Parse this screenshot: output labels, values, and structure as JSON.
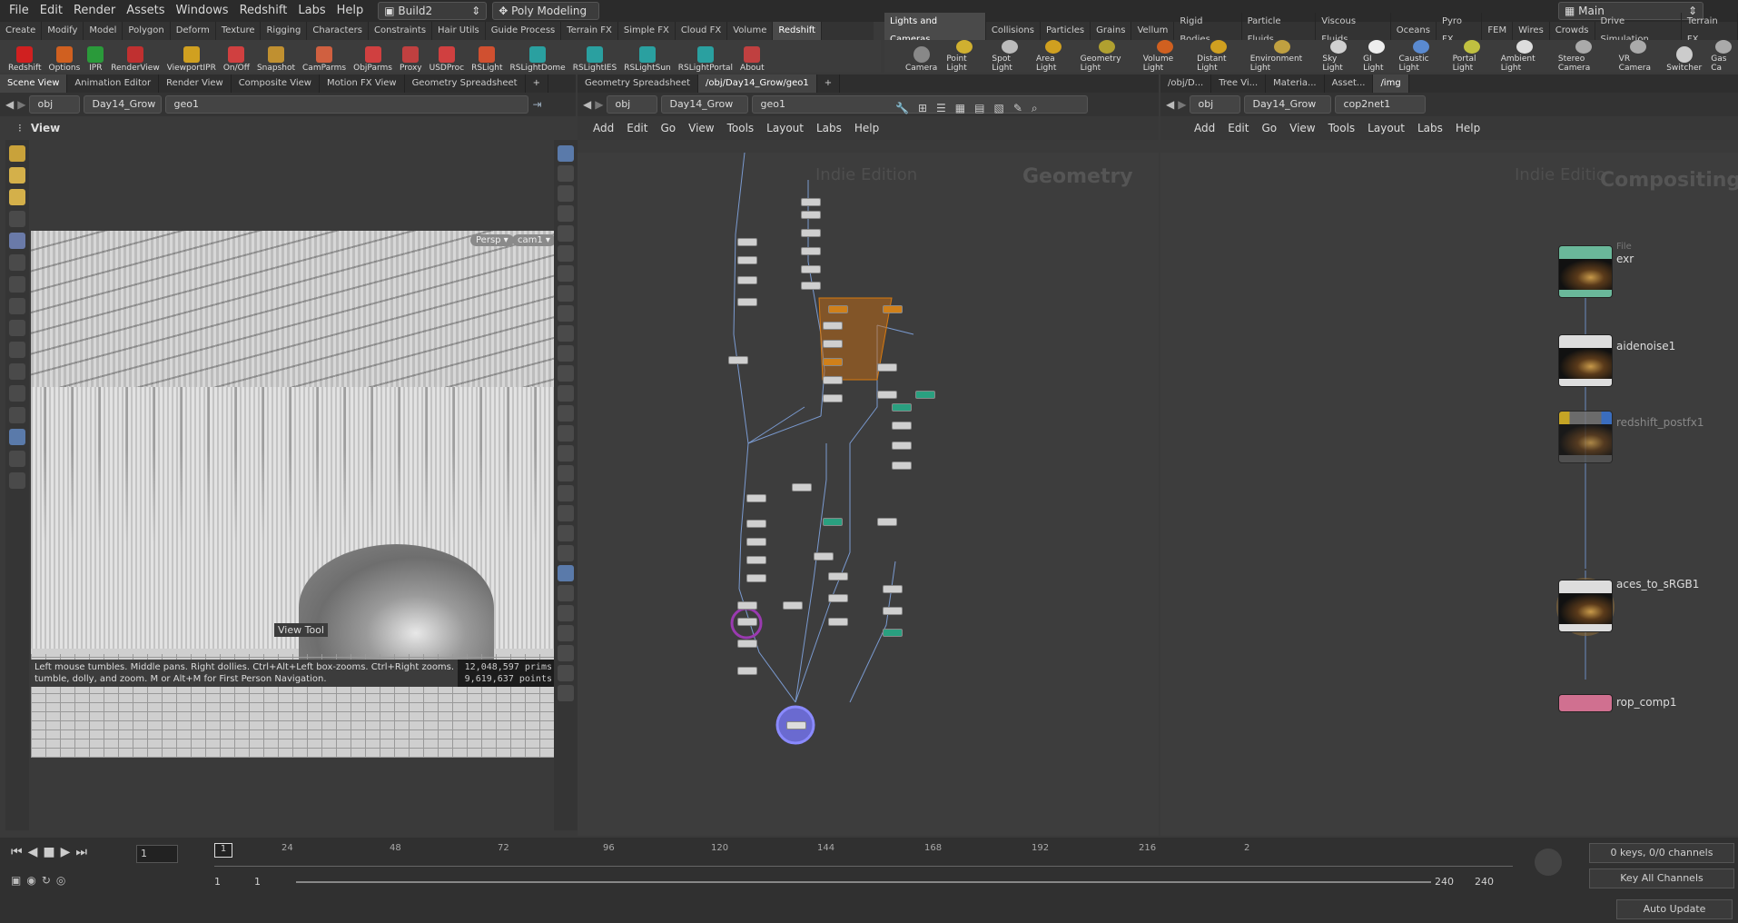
{
  "menubar": {
    "items": [
      "File",
      "Edit",
      "Render",
      "Assets",
      "Windows",
      "Redshift",
      "Labs",
      "Help"
    ],
    "desktop": "Build2",
    "mode": "Poly Modeling",
    "main": "Main"
  },
  "left_shelf_tabs": [
    "Create",
    "Modify",
    "Model",
    "Polygon",
    "Deform",
    "Texture",
    "Rigging",
    "Characters",
    "Constraints",
    "Hair Utils",
    "Guide Process",
    "Terrain FX",
    "Simple FX",
    "Cloud FX",
    "Volume",
    "Redshift"
  ],
  "right_shelf_tabs": [
    "Lights and Cameras",
    "Collisions",
    "Particles",
    "Grains",
    "Vellum",
    "Rigid Bodies",
    "Particle Fluids",
    "Viscous Fluids",
    "Oceans",
    "Pyro FX",
    "FEM",
    "Wires",
    "Crowds",
    "Drive Simulation",
    "Terrain FX"
  ],
  "left_tools": [
    "Redshift",
    "Options",
    "IPR",
    "RenderView",
    "ViewportIPR",
    "On/Off",
    "Snapshot",
    "CamParms",
    "ObjParms",
    "Proxy",
    "USDProc",
    "RSLight",
    "RSLightDome",
    "RSLightIES",
    "RSLightSun",
    "RSLightPortal",
    "About"
  ],
  "right_tools": [
    "Camera",
    "Point Light",
    "Spot Light",
    "Area Light",
    "Geometry Light",
    "Volume Light",
    "Distant Light",
    "Environment Light",
    "Sky Light",
    "GI Light",
    "Caustic Light",
    "Portal Light",
    "Ambient Light",
    "Stereo Camera",
    "VR Camera",
    "Switcher",
    "Gas Ca"
  ],
  "left_pane": {
    "tabs": [
      "Scene View",
      "Animation Editor",
      "Render View",
      "Composite View",
      "Motion FX View",
      "Geometry Spreadsheet"
    ],
    "path": [
      "obj",
      "Day14_Grow",
      "geo1"
    ],
    "view_label": "View",
    "persp": "Persp",
    "cam": "cam1",
    "tool_label": "View Tool",
    "hint": "Left mouse tumbles. Middle pans. Right dollies. Ctrl+Alt+Left box-zooms. Ctrl+Right zooms. Spacebar-Ctrl-Left tilts. H",
    "hint2": "tumble, dolly, and zoom.    M or Alt+M for First Person Navigation.",
    "prims": "12,048,597",
    "prims_label": "prims",
    "points": "9,619,637",
    "points_label": "points"
  },
  "mid_pane": {
    "tabs": [
      "Geometry Spreadsheet",
      "/obj/Day14_Grow/geo1"
    ],
    "path": [
      "obj",
      "Day14_Grow",
      "geo1"
    ],
    "menu": [
      "Add",
      "Edit",
      "Go",
      "View",
      "Tools",
      "Layout",
      "Labs",
      "Help"
    ],
    "watermark": "Indie Edition",
    "context": "Geometry"
  },
  "right_pane": {
    "tabs": [
      "/obj/D...",
      "Tree Vi...",
      "Materia...",
      "Asset...",
      "/img"
    ],
    "path": [
      "obj",
      "Day14_Grow",
      "cop2net1"
    ],
    "menu": [
      "Add",
      "Edit",
      "Go",
      "View",
      "Tools",
      "Layout",
      "Labs",
      "Help"
    ],
    "watermark": "Indie Editio",
    "context": "Compositing",
    "nodes": [
      {
        "name": "exr",
        "type": "File"
      },
      {
        "name": "aidenoise1"
      },
      {
        "name": "redshift_postfx1"
      },
      {
        "name": "aces_to_sRGB1"
      },
      {
        "name": "rop_comp1"
      }
    ]
  },
  "timeline": {
    "frame": "1",
    "ticks": [
      "24",
      "48",
      "72",
      "96",
      "120",
      "144",
      "168",
      "192",
      "216",
      "2"
    ],
    "start": "1",
    "start2": "1",
    "end": "240",
    "end2": "240",
    "keys": "0 keys, 0/0 channels",
    "key_all": "Key All Channels",
    "auto_update": "Auto Update",
    "cur": "1"
  }
}
